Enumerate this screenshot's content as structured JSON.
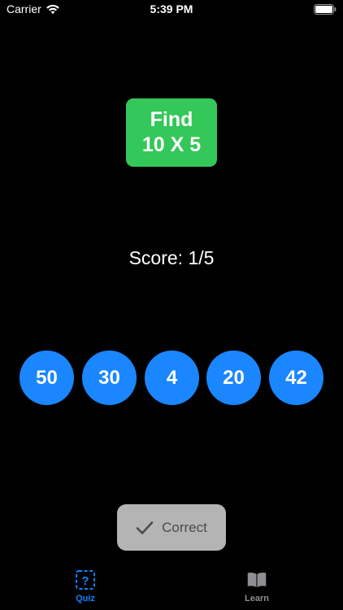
{
  "status_bar": {
    "carrier": "Carrier",
    "time": "5:39 PM",
    "wifi_icon": "wifi-icon",
    "battery_icon": "battery-icon"
  },
  "question": {
    "line1": "Find",
    "line2": "10 X 5",
    "color": "#34c759"
  },
  "score": {
    "text": "Score: 1/5"
  },
  "answers": [
    "50",
    "30",
    "4",
    "20",
    "42"
  ],
  "answer_color": "#1a86ff",
  "toast": {
    "icon": "checkmark-icon",
    "text": "Correct"
  },
  "tabs": [
    {
      "label": "Quiz",
      "icon": "question-square-icon",
      "active": true,
      "color": "#0a84ff"
    },
    {
      "label": "Learn",
      "icon": "book-icon",
      "active": false,
      "color": "#8e8e93"
    }
  ]
}
